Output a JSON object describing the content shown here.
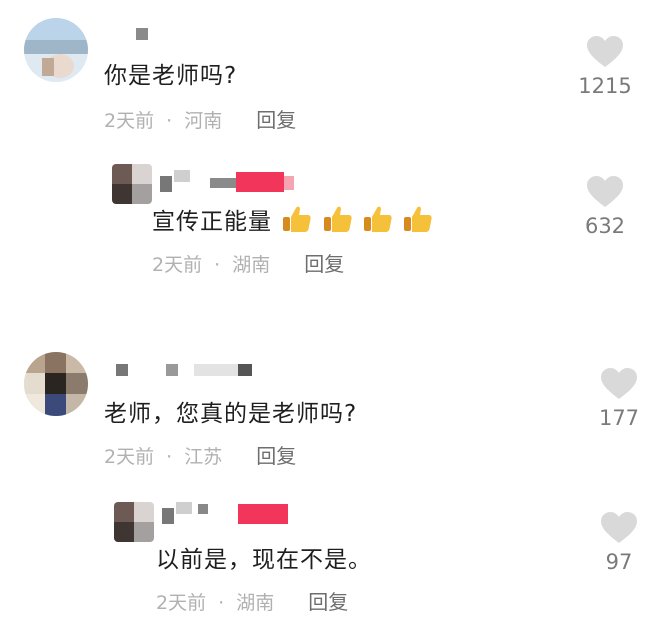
{
  "comments": [
    {
      "text": "你是老师吗?",
      "time": "2天前",
      "sep": "·",
      "location": "河南",
      "reply_label": "回复",
      "likes": "1215"
    },
    {
      "text": "宣传正能量",
      "emoji": [
        "thumbs-up",
        "thumbs-up",
        "thumbs-up",
        "thumbs-up"
      ],
      "time": "2天前",
      "sep": "·",
      "location": "湖南",
      "reply_label": "回复",
      "likes": "632"
    },
    {
      "text": "老师，您真的是老师吗?",
      "time": "2天前",
      "sep": "·",
      "location": "江苏",
      "reply_label": "回复",
      "likes": "177"
    },
    {
      "text": "以前是，现在不是。",
      "time": "2天前",
      "sep": "·",
      "location": "湖南",
      "reply_label": "回复",
      "likes": "97"
    }
  ],
  "colors": {
    "heart": "#d9d9d9",
    "meta": "#b1b1b1",
    "text": "#1f1f1f",
    "redacted_accent": "#f2355a"
  }
}
